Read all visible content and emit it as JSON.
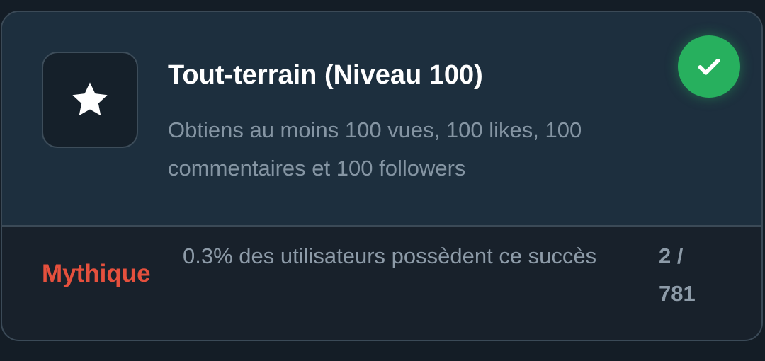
{
  "achievement": {
    "icon": "star-icon",
    "title": "Tout-terrain (Niveau 100)",
    "description": "Obtiens au moins 100 vues, 100 likes, 100 commentaires et 100 followers",
    "status_icon": "checkmark-icon",
    "unlocked": true
  },
  "stats": {
    "rarity": "Mythique",
    "owners_text": "0.3% des utilisateurs possèdent ce succès",
    "count_line1": "2 /",
    "count_line2": "781"
  },
  "colors": {
    "accent_green": "#27b05e",
    "rarity_red": "#e5503d",
    "card_top_bg": "#1d2f3e",
    "card_bottom_bg": "#18212b"
  }
}
